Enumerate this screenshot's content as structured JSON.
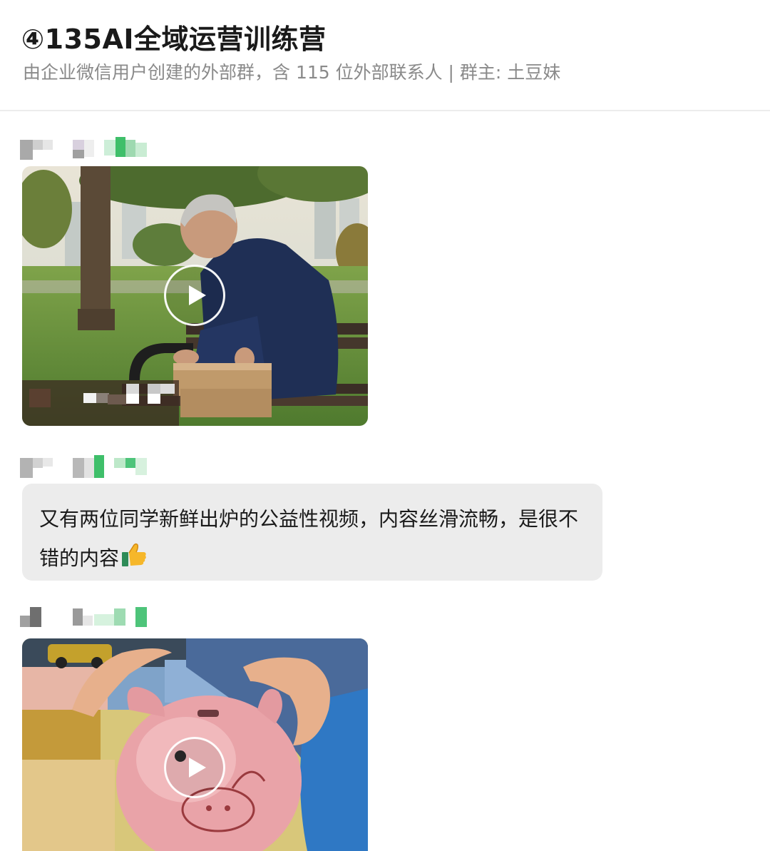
{
  "header": {
    "title": "④135AI全域运营训练营",
    "subtitle": "由企业微信用户创建的外部群，含 115 位外部联系人 | 群主: 土豆妹"
  },
  "messages": [
    {
      "type": "video",
      "sender_name_hidden": true
    },
    {
      "type": "text",
      "text": "又有两位同学新鲜出炉的公益性视频，内容丝滑流畅，是很不错的内容",
      "emoji": "thumbs-up-icon"
    },
    {
      "type": "video",
      "sender_name_hidden": true
    }
  ],
  "colors": {
    "bubble": "#ececec",
    "subtitle": "#8a8a8a",
    "divider": "#ececec"
  }
}
